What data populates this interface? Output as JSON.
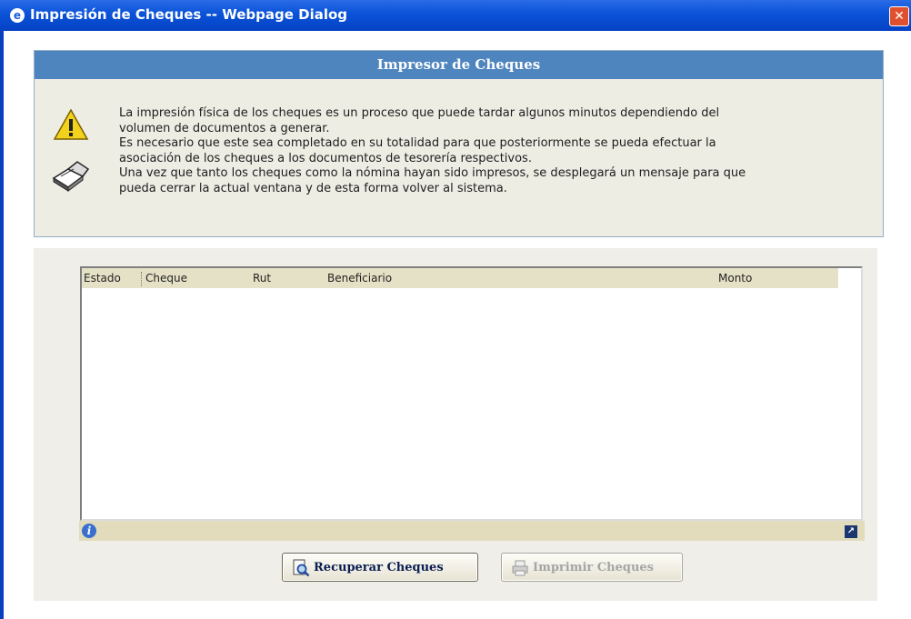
{
  "window": {
    "title": "Impresión de Cheques -- Webpage Dialog",
    "app_icon": "ie-icon",
    "close_label": "✕"
  },
  "panel": {
    "header": "Impresor de Cheques",
    "message_lines": [
      "La impresión física de los cheques es un proceso que puede tardar algunos minutos dependiendo del",
      "volumen de documentos a generar.",
      "Es necesario que este sea completado en su totalidad para que posteriormente se pueda efectuar la",
      "asociación de los cheques a los documentos de tesorería respectivos.",
      "Una vez que tanto los cheques como la nómina hayan sido impresos, se desplegará un mensaje para que",
      "pueda cerrar la actual ventana y de esta forma volver al sistema."
    ]
  },
  "grid": {
    "columns": [
      "Estado",
      "Cheque",
      "Rut",
      "Beneficiario",
      "Monto"
    ],
    "rows": []
  },
  "buttons": {
    "recuperar": "Recuperar Cheques",
    "imprimir": "Imprimir Cheques"
  },
  "colors": {
    "titlebar": "#0a52d8",
    "panel_header": "#4f85bf",
    "grid_header": "#e5e1c6"
  }
}
